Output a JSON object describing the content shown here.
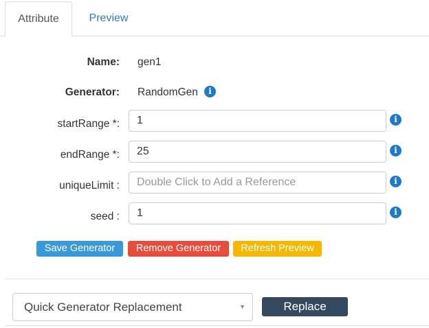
{
  "tabs": {
    "attribute": "Attribute",
    "preview": "Preview"
  },
  "fields": {
    "name": {
      "label": "Name:",
      "value": "gen1"
    },
    "generator": {
      "label": "Generator:",
      "value": "RandomGen"
    },
    "start_range": {
      "label": "startRange *:",
      "value": "1"
    },
    "end_range": {
      "label": "endRange *:",
      "value": "25"
    },
    "unique_limit": {
      "label": "uniqueLimit :",
      "value": "",
      "placeholder": "Double Click to Add a Reference"
    },
    "seed": {
      "label": "seed :",
      "value": "1"
    }
  },
  "icons": {
    "info": "info-circle-icon",
    "caret": "caret-down-icon"
  },
  "info_glyph": "i",
  "buttons": {
    "save": "Save Generator",
    "remove": "Remove Generator",
    "refresh": "Refresh Preview",
    "replace": "Replace"
  },
  "replacement": {
    "selected": "Quick Generator Replacement"
  },
  "colors": {
    "link": "#337ab7",
    "info": "#1f7ac5",
    "save": "#3a9ad9",
    "remove": "#e74c3c",
    "refresh": "#f5b700",
    "replace": "#34495e"
  }
}
